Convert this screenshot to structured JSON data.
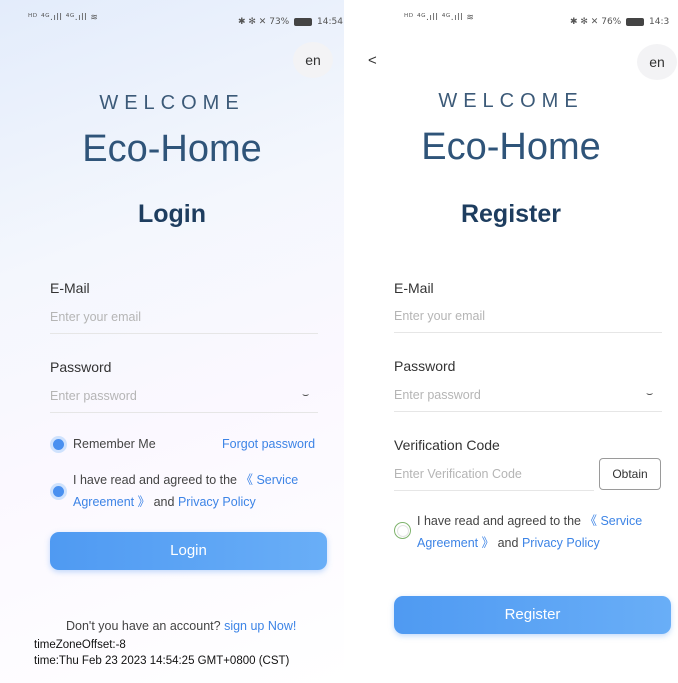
{
  "login": {
    "status_left": "ᴴᴰ ⁴ᴳ.ıll ⁴ᴳ.ıll ≋",
    "status_icons": "✱ ✻ ✕",
    "battery_pct": "73%",
    "time": "14:54",
    "lang": "en",
    "welcome": "WELCOME",
    "brand": "Eco-Home",
    "title": "Login",
    "email_label": "E-Mail",
    "email_placeholder": "Enter your email",
    "password_label": "Password",
    "password_placeholder": "Enter password",
    "eye_glyph": "⌣",
    "remember_label": "Remember Me",
    "forgot_label": "Forgot password",
    "agree_prefix": "I have read and agreed to the",
    "service_link": "《 Service Agreement 》",
    "and_text": "and",
    "privacy_link": "Privacy Policy",
    "button_label": "Login",
    "signup_prompt": "Don't you have an account?",
    "signup_link": "sign up Now!",
    "debug_offset": "timeZoneOffset:-8",
    "debug_time": "time:Thu Feb 23 2023 14:54:25 GMT+0800 (CST)"
  },
  "register": {
    "status_left": "ᴴᴰ ⁴ᴳ.ıll ⁴ᴳ.ıll ≋",
    "status_icons": "✱ ✻ ✕",
    "battery_pct": "76%",
    "time": "14:3",
    "back_glyph": "<",
    "lang": "en",
    "welcome": "WELCOME",
    "brand": "Eco-Home",
    "title": "Register",
    "email_label": "E-Mail",
    "email_placeholder": "Enter your email",
    "password_label": "Password",
    "password_placeholder": "Enter password",
    "eye_glyph": "⌣",
    "code_label": "Verification Code",
    "code_placeholder": "Enter Verification Code",
    "obtain_label": "Obtain",
    "agree_prefix": "I have read and agreed to the",
    "service_link": "《 Service Agreement 》",
    "and_text": "and",
    "privacy_link": "Privacy Policy",
    "button_label": "Register"
  }
}
